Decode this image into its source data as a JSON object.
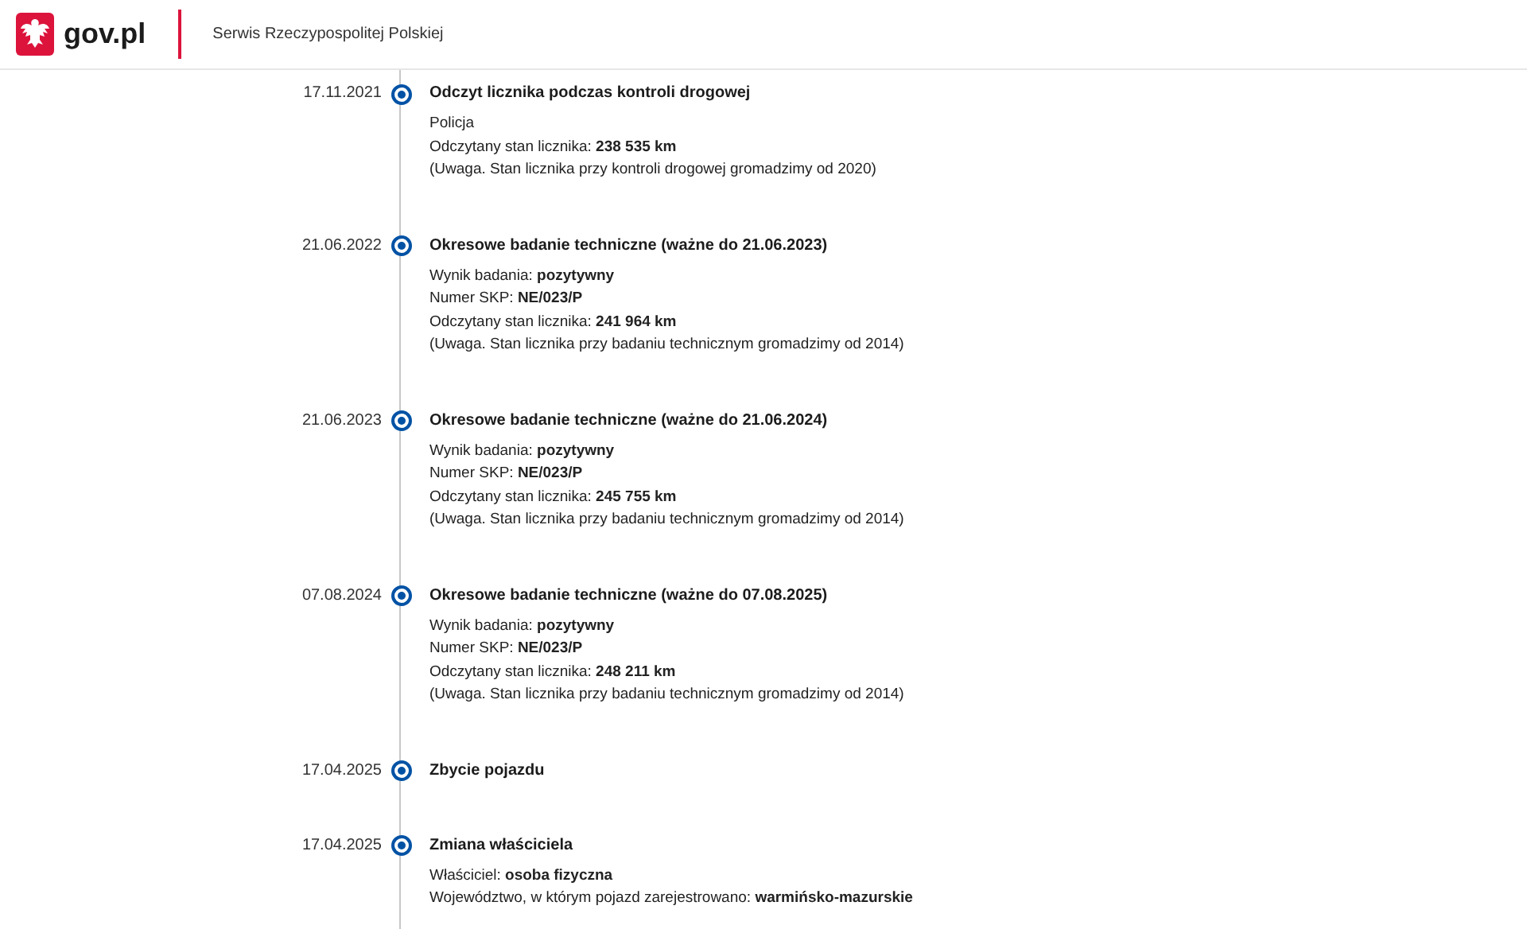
{
  "header": {
    "logo_text": "gov.pl",
    "service_name": "Serwis Rzeczypospolitej Polskiej"
  },
  "events": [
    {
      "date": "17.11.2021",
      "title": "Odczyt licznika podczas kontroli drogowej",
      "lines": [
        "Policja",
        "Odczytany stan licznika: **238 535 km**",
        "(Uwaga. Stan licznika przy kontroli drogowej gromadzimy od 2020)"
      ]
    },
    {
      "date": "21.06.2022",
      "title": "Okresowe badanie techniczne (ważne do 21.06.2023)",
      "lines": [
        "Wynik badania: **pozytywny**",
        "Numer SKP: **NE/023/P**",
        "Odczytany stan licznika: **241 964 km**",
        "(Uwaga. Stan licznika przy badaniu technicznym gromadzimy od 2014)"
      ]
    },
    {
      "date": "21.06.2023",
      "title": "Okresowe badanie techniczne (ważne do 21.06.2024)",
      "lines": [
        "Wynik badania: **pozytywny**",
        "Numer SKP: **NE/023/P**",
        "Odczytany stan licznika: **245 755 km**",
        "(Uwaga. Stan licznika przy badaniu technicznym gromadzimy od 2014)"
      ]
    },
    {
      "date": "07.08.2024",
      "title": "Okresowe badanie techniczne (ważne do 07.08.2025)",
      "lines": [
        "Wynik badania: **pozytywny**",
        "Numer SKP: **NE/023/P**",
        "Odczytany stan licznika: **248 211 km**",
        "(Uwaga. Stan licznika przy badaniu technicznym gromadzimy od 2014)"
      ]
    },
    {
      "date": "17.04.2025",
      "title": "Zbycie pojazdu"
    },
    {
      "date": "17.04.2025",
      "title": "Zmiana właściciela",
      "lines": [
        "Właściciel: **osoba fizyczna**",
        "Województwo, w którym pojazd zarejestrowano: **warmińsko-mazurskie**"
      ]
    }
  ]
}
